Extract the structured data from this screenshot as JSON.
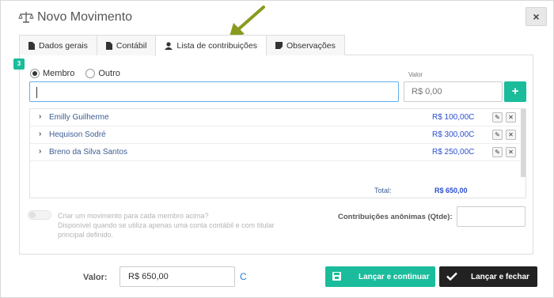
{
  "modal": {
    "title": "Novo Movimento",
    "close_label": "×"
  },
  "tabs": [
    {
      "label": "Dados gerais",
      "active": false
    },
    {
      "label": "Contábil",
      "active": false
    },
    {
      "label": "Lista de contribuições",
      "active": true
    },
    {
      "label": "Observações",
      "active": false
    }
  ],
  "step_badge": "3",
  "radios": {
    "membro_label": "Membro",
    "membro_checked": true,
    "outro_label": "Outro",
    "outro_checked": false
  },
  "valor_label": "Valor",
  "member_input": {
    "value": ""
  },
  "valor_input": {
    "placeholder": "R$ 0,00"
  },
  "add_button_label": "+",
  "contributions": [
    {
      "name": "Emilly Guilherme",
      "amount": "R$ 100,00C"
    },
    {
      "name": "Hequison Sodré",
      "amount": "R$ 300,00C"
    },
    {
      "name": "Breno da Silva Santos",
      "amount": "R$ 250,00C"
    }
  ],
  "total": {
    "label": "Total:",
    "value": "R$ 650,00"
  },
  "option_text": {
    "line1": "Criar um movimento para cada membro acima?",
    "line2": "Disponível quando se utiliza apenas uma conta contábil e com titular principal definido."
  },
  "anon_label": "Contribuições anônimas (Qtde):",
  "anon_input": {
    "value": ""
  },
  "footer": {
    "valor_label": "Valor:",
    "valor_value": "R$ 650,00",
    "suffix": "C"
  },
  "buttons": {
    "continue_label": "Lançar e continuar",
    "close_label": "Lançar e fechar"
  },
  "colors": {
    "accent": "#1abc9c",
    "amount": "#2b4fd0",
    "dark_button": "#222222"
  },
  "icons": [
    "balance-scale-icon",
    "file-icon",
    "user-icon",
    "sticky-note-icon",
    "plus-icon",
    "chevron-right-icon",
    "edit-icon",
    "close-icon",
    "save-icon",
    "check-icon"
  ]
}
